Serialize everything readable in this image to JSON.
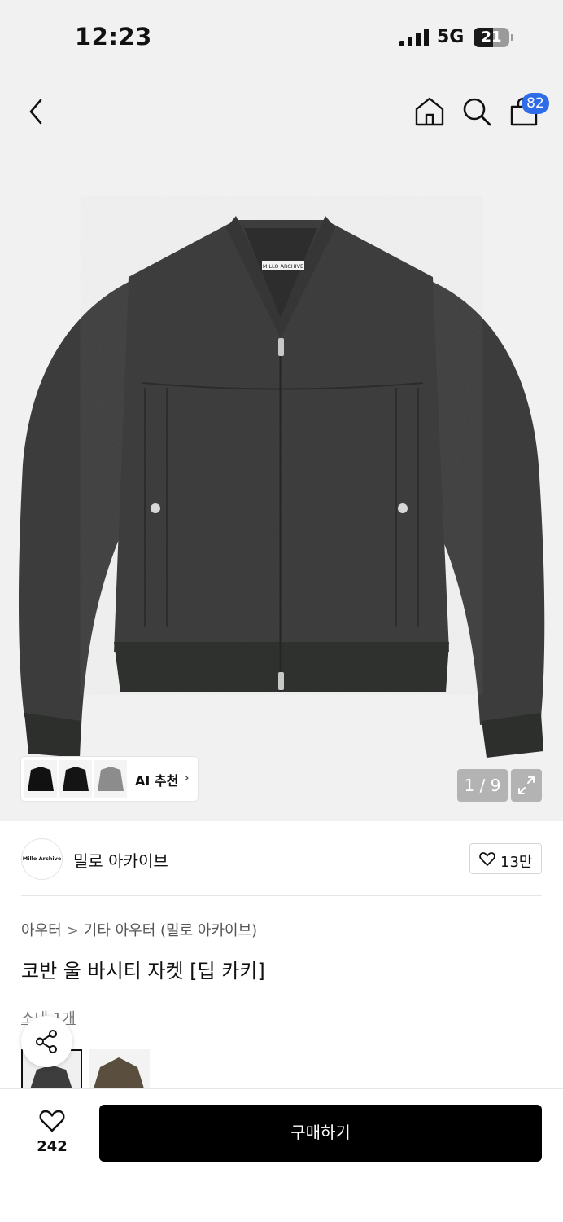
{
  "status_bar": {
    "time": "12:23",
    "network": "5G",
    "battery": "21"
  },
  "header": {
    "cart_count": "82"
  },
  "gallery": {
    "jacket_label": "MILLO ARCHIVE",
    "ai_label": "AI 추천",
    "counter": "1 / 9",
    "thumbnail_colors": [
      "#111111",
      "#141414",
      "#8c8c8c"
    ]
  },
  "brand": {
    "logo_text": "Millo Archive",
    "name": "밀로 아카이브",
    "likes": "13만"
  },
  "breadcrumb": {
    "category": "아우터",
    "separator": ">",
    "subcategory": "기타 아우터 (밀로 아카이브)"
  },
  "product": {
    "title": "코반 울 바시티 자켓 [딥 카키]",
    "stock_note": "소내 1개"
  },
  "color_options": [
    "#3c3d3c",
    "#5a4f3f"
  ],
  "bottom_bar": {
    "wish_count": "242",
    "buy_label": "구매하기"
  },
  "colors": {
    "accent": "#2f6ce8",
    "buy_button": "#000000",
    "jacket": "#3e3f3e"
  }
}
